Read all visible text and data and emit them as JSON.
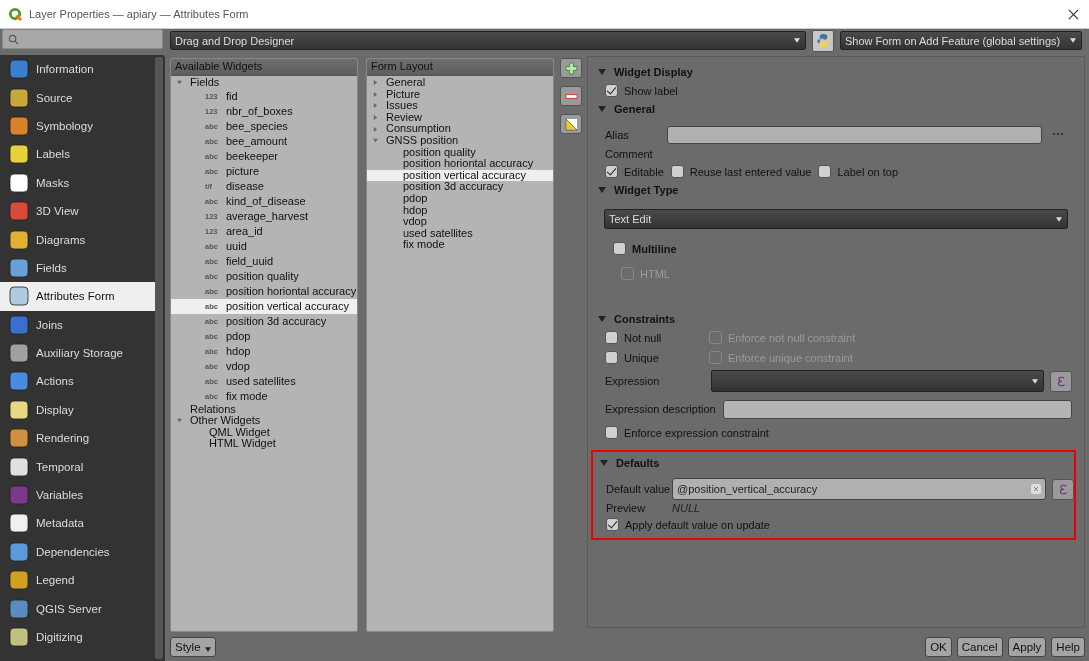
{
  "window": {
    "title": "Layer Properties — apiary — Attributes Form"
  },
  "sidebar": {
    "items": [
      {
        "label": "Information",
        "selected": false
      },
      {
        "label": "Source",
        "selected": false
      },
      {
        "label": "Symbology",
        "selected": false
      },
      {
        "label": "Labels",
        "selected": false
      },
      {
        "label": "Masks",
        "selected": false
      },
      {
        "label": "3D View",
        "selected": false
      },
      {
        "label": "Diagrams",
        "selected": false
      },
      {
        "label": "Fields",
        "selected": false
      },
      {
        "label": "Attributes Form",
        "selected": true
      },
      {
        "label": "Joins",
        "selected": false
      },
      {
        "label": "Auxiliary Storage",
        "selected": false
      },
      {
        "label": "Actions",
        "selected": false
      },
      {
        "label": "Display",
        "selected": false
      },
      {
        "label": "Rendering",
        "selected": false
      },
      {
        "label": "Temporal",
        "selected": false
      },
      {
        "label": "Variables",
        "selected": false
      },
      {
        "label": "Metadata",
        "selected": false
      },
      {
        "label": "Dependencies",
        "selected": false
      },
      {
        "label": "Legend",
        "selected": false
      },
      {
        "label": "QGIS Server",
        "selected": false
      },
      {
        "label": "Digitizing",
        "selected": false
      }
    ]
  },
  "toolbar": {
    "designer_dropdown": "Drag and Drop Designer",
    "show_form_dropdown": "Show Form on Add Feature (global settings)"
  },
  "available_widgets": {
    "header": "Available Widgets",
    "tree": [
      {
        "label": "Fields",
        "expanded": true,
        "children": [
          {
            "type": "123",
            "label": "fid",
            "selected": false
          },
          {
            "type": "123",
            "label": "nbr_of_boxes",
            "selected": false
          },
          {
            "type": "abc",
            "label": "bee_species",
            "selected": false
          },
          {
            "type": "abc",
            "label": "bee_amount",
            "selected": false
          },
          {
            "type": "abc",
            "label": "beekeeper",
            "selected": false
          },
          {
            "type": "abc",
            "label": "picture",
            "selected": false
          },
          {
            "type": "t/f",
            "label": "disease",
            "selected": false
          },
          {
            "type": "abc",
            "label": "kind_of_disease",
            "selected": false
          },
          {
            "type": "123",
            "label": "average_harvest",
            "selected": false
          },
          {
            "type": "123",
            "label": "area_id",
            "selected": false
          },
          {
            "type": "abc",
            "label": "uuid",
            "selected": false
          },
          {
            "type": "abc",
            "label": "field_uuid",
            "selected": false
          },
          {
            "type": "abc",
            "label": "position quality",
            "selected": false
          },
          {
            "type": "abc",
            "label": "position horiontal accuracy",
            "selected": false
          },
          {
            "type": "abc",
            "label": "position vertical accuracy",
            "selected": true
          },
          {
            "type": "abc",
            "label": "position 3d accuracy",
            "selected": false
          },
          {
            "type": "abc",
            "label": "pdop",
            "selected": false
          },
          {
            "type": "abc",
            "label": "hdop",
            "selected": false
          },
          {
            "type": "abc",
            "label": "vdop",
            "selected": false
          },
          {
            "type": "abc",
            "label": "used satellites",
            "selected": false
          },
          {
            "type": "abc",
            "label": "fix mode",
            "selected": false
          }
        ]
      },
      {
        "label": "Relations"
      },
      {
        "label": "Other Widgets",
        "expanded": true,
        "children": [
          {
            "label": "QML Widget",
            "selected": false
          },
          {
            "label": "HTML Widget",
            "selected": false
          }
        ]
      }
    ]
  },
  "form_layout": {
    "header": "Form Layout",
    "tree": [
      {
        "label": "General",
        "expanded": false
      },
      {
        "label": "Picture",
        "expanded": false
      },
      {
        "label": "Issues",
        "expanded": false
      },
      {
        "label": "Review",
        "expanded": false
      },
      {
        "label": "Consumption",
        "expanded": false
      },
      {
        "label": "GNSS position",
        "expanded": true,
        "children": [
          {
            "label": "position quality",
            "selected": false
          },
          {
            "label": "position horiontal accuracy",
            "selected": false
          },
          {
            "label": "position vertical accuracy",
            "selected": true
          },
          {
            "label": "position 3d accuracy",
            "selected": false
          },
          {
            "label": "pdop",
            "selected": false
          },
          {
            "label": "hdop",
            "selected": false
          },
          {
            "label": "vdop",
            "selected": false
          },
          {
            "label": "used satellites",
            "selected": false
          },
          {
            "label": "fix mode",
            "selected": false
          }
        ]
      }
    ]
  },
  "widget_display": {
    "title": "Widget Display",
    "show_label": {
      "label": "Show label",
      "checked": true
    }
  },
  "general": {
    "title": "General",
    "alias_label": "Alias",
    "comment_label": "Comment",
    "options": [
      {
        "label": "Editable",
        "checked": true
      },
      {
        "label": "Reuse last entered value",
        "checked": false
      },
      {
        "label": "Label on top",
        "checked": false
      }
    ]
  },
  "widget_type": {
    "title": "Widget Type",
    "dropdown": "Text Edit",
    "multiline": {
      "label": "Multiline",
      "checked": false
    },
    "html": {
      "label": "HTML",
      "checked": false,
      "disabled": true
    }
  },
  "constraints": {
    "title": "Constraints",
    "rows": [
      {
        "label": "Not null",
        "checked": false,
        "enforce_label": "Enforce not null constraint",
        "enforce_checked": false,
        "enforce_disabled": true
      },
      {
        "label": "Unique",
        "checked": false,
        "enforce_label": "Enforce unique constraint",
        "enforce_checked": false,
        "enforce_disabled": true
      }
    ],
    "expression_label": "Expression",
    "expression_description_label": "Expression description",
    "enforce_expression": {
      "label": "Enforce expression constraint",
      "checked": false
    }
  },
  "defaults": {
    "title": "Defaults",
    "highlighted": true,
    "default_value_label": "Default value",
    "default_value": "@position_vertical_accuracy",
    "preview_label": "Preview",
    "preview_value": "NULL",
    "apply_on_update": {
      "label": "Apply default value on update",
      "checked": true
    }
  },
  "footer": {
    "style_button": "Style",
    "buttons": [
      "OK",
      "Cancel",
      "Apply",
      "Help"
    ]
  }
}
